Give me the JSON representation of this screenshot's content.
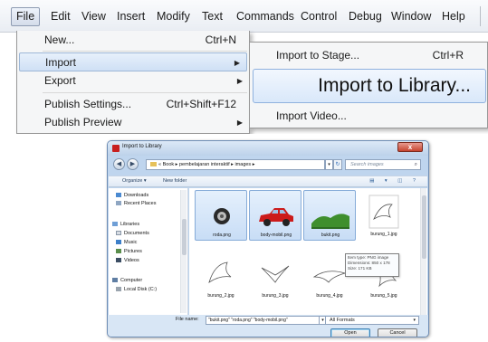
{
  "menubar": {
    "items": [
      "File",
      "Edit",
      "View",
      "Insert",
      "Modify",
      "Text",
      "Commands",
      "Control",
      "Debug",
      "Window",
      "Help"
    ],
    "active": "File"
  },
  "file_menu": {
    "new": {
      "label": "New...",
      "shortcut": "Ctrl+N"
    },
    "import": {
      "label": "Import"
    },
    "export": {
      "label": "Export"
    },
    "publish_settings": {
      "label": "Publish Settings...",
      "shortcut": "Ctrl+Shift+F12"
    },
    "publish_preview": {
      "label": "Publish Preview"
    }
  },
  "import_submenu": {
    "to_stage": {
      "label": "Import to Stage...",
      "shortcut": "Ctrl+R"
    },
    "to_library": {
      "label": "Import to Library..."
    },
    "video": {
      "label": "Import Video..."
    }
  },
  "dialog": {
    "title": "Import to Library",
    "close_glyph": "x",
    "address": {
      "prefix": "«",
      "crumbs": [
        "Book",
        "pembelajaran interaktif",
        "images"
      ]
    },
    "search_placeholder": "Search images",
    "toolbar": {
      "organize": "Organize ▾",
      "new_folder": "New folder"
    },
    "nav_pane": {
      "favorites": [
        "Downloads",
        "Recent Places"
      ],
      "libraries_header": "Libraries",
      "libraries": [
        "Documents",
        "Music",
        "Pictures",
        "Videos"
      ],
      "computer_header": "Computer",
      "computer": [
        "Local Disk (C:)"
      ]
    },
    "files": [
      {
        "name": "roda.png",
        "selected": true
      },
      {
        "name": "body-mobil.png",
        "selected": true
      },
      {
        "name": "bukit.png",
        "selected": true
      },
      {
        "name": "burung_1.jpg",
        "selected": false
      },
      {
        "name": "burung_2.jpg",
        "selected": false
      },
      {
        "name": "burung_3.jpg",
        "selected": false
      },
      {
        "name": "burung_4.jpg",
        "selected": false
      },
      {
        "name": "burung_5.jpg",
        "selected": false
      }
    ],
    "tooltip": {
      "line1": "Item type: PNG image",
      "line2": "Dimensions: 850 x 178",
      "line3": "Size: 171 KB"
    },
    "file_name_label": "File name:",
    "file_name_value": "\"bukit.png\" \"roda.png\" \"body-mobil.png\"",
    "format": "All Formats",
    "open": "Open",
    "cancel": "Cancel"
  },
  "colors": {
    "menu_highlight": "#cfe0f5",
    "dialog_frame": "#bfd5ee",
    "selection": "#c8ddf6",
    "close_red": "#c6442f"
  }
}
